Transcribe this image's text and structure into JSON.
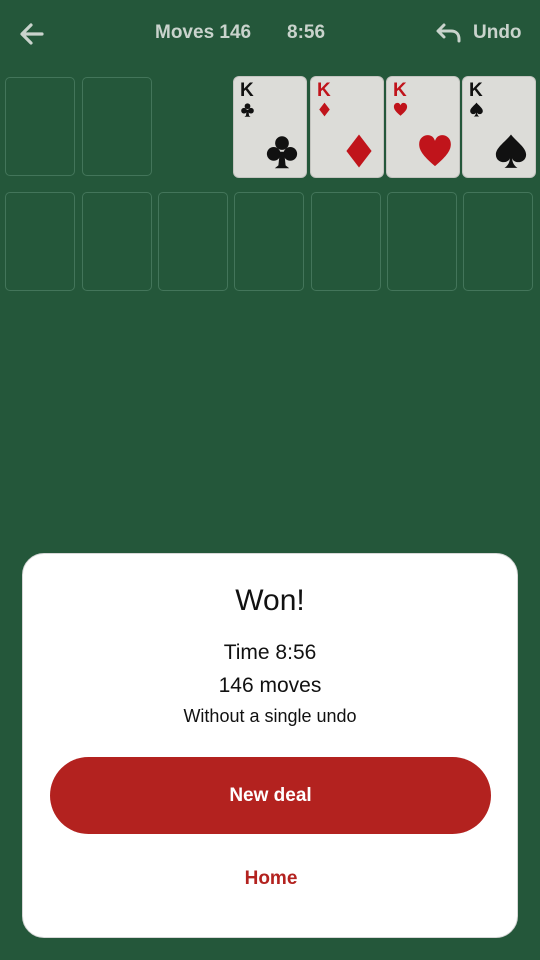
{
  "header": {
    "moves_label": "Moves 146",
    "time_label": "8:56",
    "undo_label": "Undo",
    "back_icon": "arrow-left-icon",
    "undo_icon": "undo-arrow-icon"
  },
  "foundations": [
    {
      "rank": "K",
      "suit": "clubs",
      "color": "black"
    },
    {
      "rank": "K",
      "suit": "diamonds",
      "color": "red"
    },
    {
      "rank": "K",
      "suit": "hearts",
      "color": "red"
    },
    {
      "rank": "K",
      "suit": "spades",
      "color": "black"
    }
  ],
  "free_cells": [
    "empty",
    "empty"
  ],
  "tableau": [
    "empty",
    "empty",
    "empty",
    "empty",
    "empty",
    "empty",
    "empty"
  ],
  "dialog": {
    "title": "Won!",
    "time_text": "Time 8:56",
    "moves_text": "146 moves",
    "undo_text": "Without a single undo",
    "new_deal_label": "New deal",
    "home_label": "Home"
  },
  "colors": {
    "table_green": "#24573a",
    "accent_red": "#b3221f",
    "card_face": "#dcdcd8"
  }
}
